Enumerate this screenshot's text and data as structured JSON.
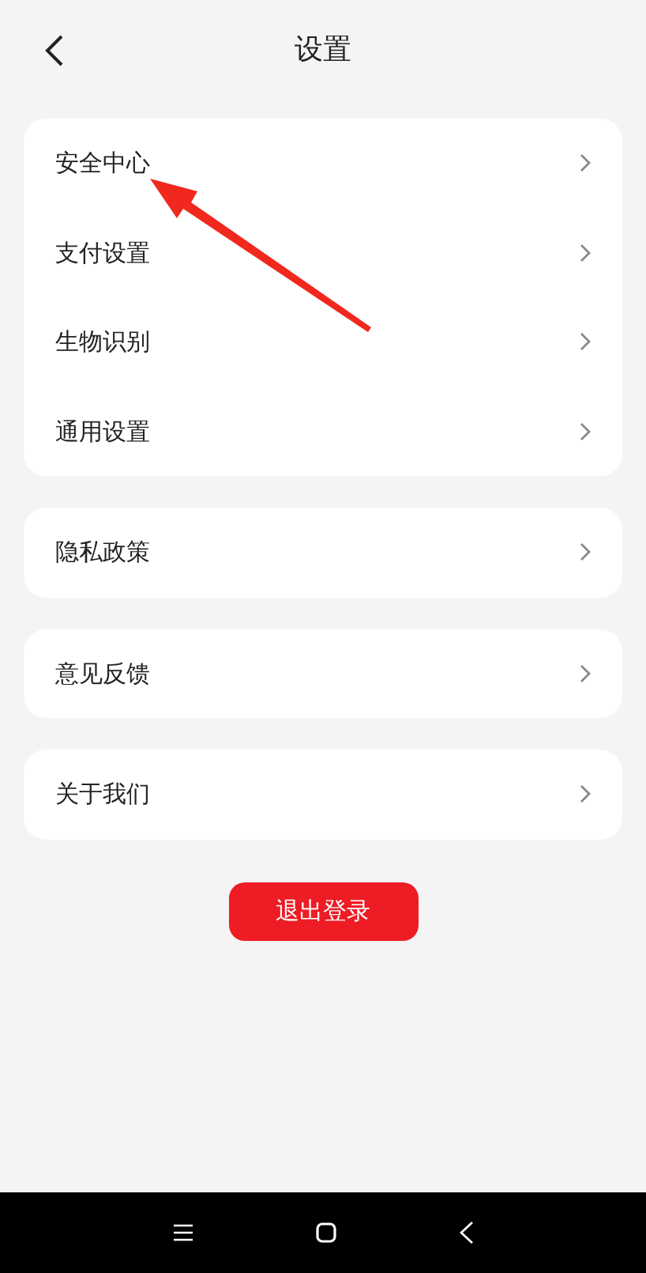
{
  "header": {
    "title": "设置"
  },
  "groups": [
    {
      "items": [
        {
          "label": "安全中心"
        },
        {
          "label": "支付设置"
        },
        {
          "label": "生物识别"
        },
        {
          "label": "通用设置"
        }
      ]
    },
    {
      "items": [
        {
          "label": "隐私政策"
        }
      ]
    },
    {
      "items": [
        {
          "label": "意见反馈"
        }
      ]
    },
    {
      "items": [
        {
          "label": "关于我们"
        }
      ]
    }
  ],
  "logout_button": {
    "label": "退出登录"
  }
}
